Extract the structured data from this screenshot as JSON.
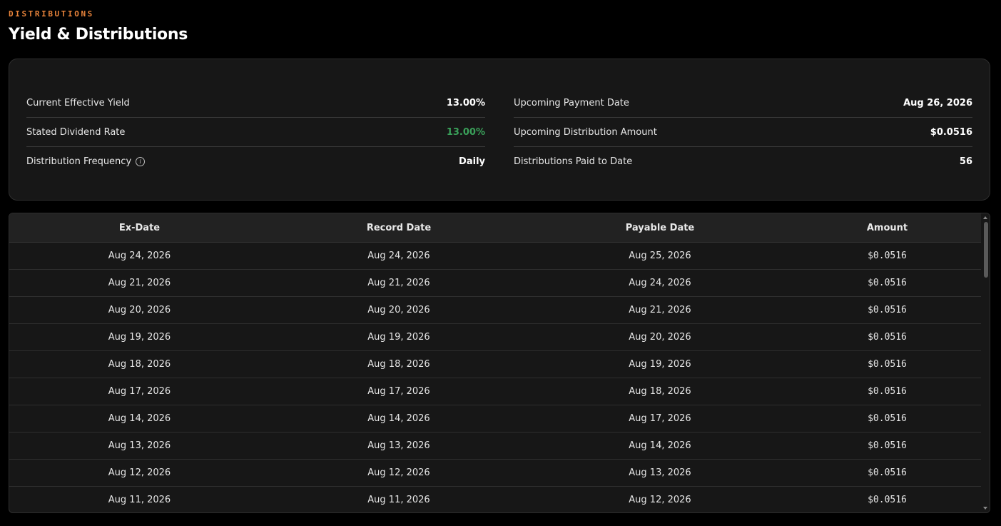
{
  "header": {
    "eyebrow": "DISTRIBUTIONS",
    "title": "Yield & Distributions"
  },
  "summary": {
    "left": [
      {
        "label": "Current Effective Yield",
        "value": "13.00%"
      },
      {
        "label": "Stated Dividend Rate",
        "value": "13.00%",
        "color": "#3aa15a"
      },
      {
        "label": "Distribution Frequency",
        "value": "Daily",
        "icon": "info-icon"
      }
    ],
    "right": [
      {
        "label": "Upcoming Payment Date",
        "value": "Aug 26, 2026"
      },
      {
        "label": "Upcoming Distribution Amount",
        "value": "$0.0516"
      },
      {
        "label": "Distributions Paid to Date",
        "value": "56"
      }
    ]
  },
  "table": {
    "columns": [
      "Ex-Date",
      "Record Date",
      "Payable Date",
      "Amount"
    ],
    "rows": [
      [
        "Aug 24, 2026",
        "Aug 24, 2026",
        "Aug 25, 2026",
        "$0.0516"
      ],
      [
        "Aug 21, 2026",
        "Aug 21, 2026",
        "Aug 24, 2026",
        "$0.0516"
      ],
      [
        "Aug 20, 2026",
        "Aug 20, 2026",
        "Aug 21, 2026",
        "$0.0516"
      ],
      [
        "Aug 19, 2026",
        "Aug 19, 2026",
        "Aug 20, 2026",
        "$0.0516"
      ],
      [
        "Aug 18, 2026",
        "Aug 18, 2026",
        "Aug 19, 2026",
        "$0.0516"
      ],
      [
        "Aug 17, 2026",
        "Aug 17, 2026",
        "Aug 18, 2026",
        "$0.0516"
      ],
      [
        "Aug 14, 2026",
        "Aug 14, 2026",
        "Aug 17, 2026",
        "$0.0516"
      ],
      [
        "Aug 13, 2026",
        "Aug 13, 2026",
        "Aug 14, 2026",
        "$0.0516"
      ],
      [
        "Aug 12, 2026",
        "Aug 12, 2026",
        "Aug 13, 2026",
        "$0.0516"
      ],
      [
        "Aug 11, 2026",
        "Aug 11, 2026",
        "Aug 12, 2026",
        "$0.0516"
      ]
    ]
  },
  "colors": {
    "accent": "#e8833a",
    "positive": "#3aa15a",
    "background": "#000000",
    "card": "#171717"
  }
}
